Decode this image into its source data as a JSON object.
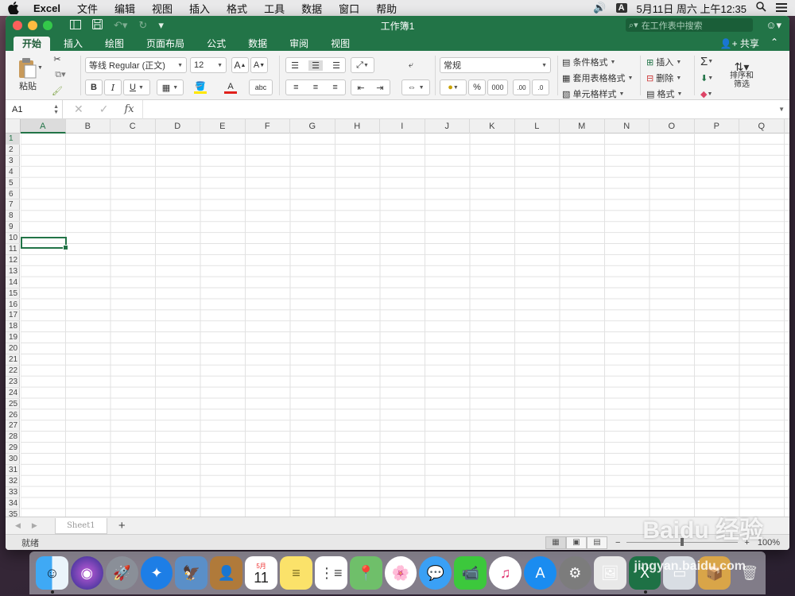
{
  "menubar": {
    "app": "Excel",
    "items": [
      "文件",
      "编辑",
      "视图",
      "插入",
      "格式",
      "工具",
      "数据",
      "窗口",
      "帮助"
    ],
    "input_badge": "A",
    "datetime": "5月11日 周六 上午12:35"
  },
  "window": {
    "title": "工作簿1",
    "search_placeholder": "在工作表中搜索",
    "share_label": "共享"
  },
  "ribbon_tabs": [
    "开始",
    "插入",
    "绘图",
    "页面布局",
    "公式",
    "数据",
    "审阅",
    "视图"
  ],
  "ribbon": {
    "paste_label": "粘贴",
    "font_name": "等线 Regular (正文)",
    "font_size": "12",
    "grow_font": "A",
    "shrink_font": "A",
    "bold": "B",
    "italic": "I",
    "underline": "U",
    "font_color_letter": "A",
    "phonetic_label": "abc",
    "number_format": "常规",
    "percent": "%",
    "thousands": "000",
    "inc_decimal": ".00",
    "dec_decimal": ".0",
    "cond_format": "条件格式",
    "table_format": "套用表格格式",
    "cell_styles": "单元格样式",
    "insert": "插入",
    "delete": "删除",
    "format": "格式",
    "sum_symbol": "Σ",
    "sort_filter_line1": "排序和",
    "sort_filter_line2": "筛选",
    "colors": {
      "accent": "#227447",
      "fill_yellow": "#ffe700",
      "font_red": "#e0201b"
    }
  },
  "formula_bar": {
    "name_box": "A1",
    "cancel_icon": "✕",
    "enter_icon": "✓",
    "fx_label": "fx",
    "value": ""
  },
  "columns": [
    "A",
    "B",
    "C",
    "D",
    "E",
    "F",
    "G",
    "H",
    "I",
    "J",
    "K",
    "L",
    "M",
    "N",
    "O",
    "P",
    "Q"
  ],
  "rows": [
    "1",
    "2",
    "3",
    "4",
    "5",
    "6",
    "7",
    "8",
    "9",
    "10",
    "11",
    "12",
    "13",
    "14",
    "15",
    "16",
    "17",
    "18",
    "19",
    "20",
    "21",
    "22",
    "23",
    "24",
    "25",
    "26",
    "27",
    "28",
    "29",
    "30",
    "31",
    "32",
    "33",
    "34",
    "35"
  ],
  "selected_cell": "A1",
  "sheets": [
    "Sheet1"
  ],
  "status": {
    "ready": "就绪",
    "zoom": "100%"
  },
  "dock": {
    "calendar_month": "5月",
    "calendar_day": "11"
  },
  "watermark": {
    "text": "Baidu 经验",
    "subtext": "jingyan.baidu.com"
  }
}
